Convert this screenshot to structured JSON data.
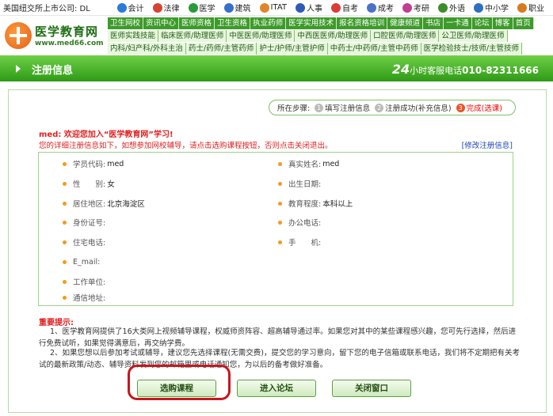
{
  "topbar": {
    "stock": "美国纽交所上市公司: DL",
    "categories": [
      {
        "label": "会计",
        "icon": "accounting-icon",
        "color": "#2d7ad6"
      },
      {
        "label": "法律",
        "icon": "law-icon",
        "color": "#d4442f"
      },
      {
        "label": "医学",
        "icon": "medical-icon",
        "color": "#2a9a3a"
      },
      {
        "label": "建筑",
        "icon": "building-icon",
        "color": "#3670c8"
      },
      {
        "label": "ITAT",
        "icon": "itat-icon",
        "color": "#e0862a"
      },
      {
        "label": "人事",
        "icon": "hr-icon",
        "color": "#2f5bb7"
      },
      {
        "label": "自考",
        "icon": "selfexam-icon",
        "color": "#d93b3b"
      },
      {
        "label": "成考",
        "icon": "adultexam-icon",
        "color": "#4a73c8"
      },
      {
        "label": "考研",
        "icon": "postgrad-icon",
        "color": "#c23e91"
      },
      {
        "label": "外语",
        "icon": "language-icon",
        "color": "#3b8e2a"
      },
      {
        "label": "中小学",
        "icon": "school-icon",
        "color": "#2e6fc2"
      },
      {
        "label": "职业",
        "icon": "career-icon",
        "color": "#d77a20"
      }
    ]
  },
  "logo": {
    "name": "医学教育网",
    "url": "www.med66.com"
  },
  "nav": {
    "row1": [
      "卫生网校",
      "资讯中心",
      "医师资格",
      "卫生资格",
      "执业药师",
      "医学实用技术",
      "报名资格培训",
      "健康频道",
      "书店",
      "一卡通",
      "论坛",
      "博客",
      "首页"
    ],
    "row2": [
      "医师实践技能",
      "临床医师/助理医师",
      "中医医师/助理医师",
      "中西医医师/助理医师",
      "口腔医师/助理医师",
      "公卫医师/助理医师"
    ],
    "row3": [
      "内科/妇产科/外科主治",
      "药士/药师/主管药师",
      "护士/护师/主管护师",
      "中药士/中药师/主管中药师",
      "医学检验技士/技师/主管技师"
    ]
  },
  "header": {
    "title": "注册信息",
    "hotline_24": "24",
    "hotline_text": "小时客服电话",
    "hotline_num": "010-82311666"
  },
  "steps": {
    "location": "所在步骤:",
    "items": [
      {
        "num": "1",
        "label": "填写注册信息",
        "active": false
      },
      {
        "num": "2",
        "label": "注册成功(补充信息)",
        "active": false
      },
      {
        "num": "3",
        "label": "完成(选课)",
        "active": true
      }
    ]
  },
  "welcome": {
    "username": "med",
    "text": ": 欢迎您加入“医学教育网”学习!",
    "desc": "您的详细注册信息如下，如想参加网校辅导，请点击选购课程按钮，否则点击关闭退出。",
    "modify_link": "[修改注册信息]"
  },
  "fields": [
    {
      "label": "学员代码:",
      "value": "med"
    },
    {
      "label": "真实姓名:",
      "value": "med"
    },
    {
      "label": "性　　别:",
      "value": "女"
    },
    {
      "label": "出生日期:",
      "value": ""
    },
    {
      "label": "居住地区:",
      "value": "北京海淀区"
    },
    {
      "label": "教育程度:",
      "value": "本科以上"
    },
    {
      "label": "身份证号:",
      "value": ""
    },
    {
      "label": "办公电话:",
      "value": ""
    },
    {
      "label": "住宅电话:",
      "value": ""
    },
    {
      "label": "手　　机:",
      "value": ""
    },
    {
      "label": "E_mail:",
      "value": ""
    },
    {
      "label": "工作单位:",
      "value": ""
    },
    {
      "label": "通信地址:",
      "value": ""
    }
  ],
  "notes": {
    "title": "重要提示:",
    "note1": "1、医学教育网提供了16大类网上视频辅导课程，权威师资阵容、超高辅导通过率。如果您对其中的某些课程感兴趣，您可先行选择，然后进行免费试听，如果觉得满意后，再交纳学费。",
    "note2": "2、如果您想以后参加考试或辅导，建议您先选择课程(无需交费)，提交您的学习意向，留下您的电子信箱或联系电话，我们将不定期把有关考试的最新政策/动态、辅导资料发到您的邮箱里或电话通知您，为以后的备考做好准备。"
  },
  "buttons": {
    "select_course": "选购课程",
    "enter_forum": "进入论坛",
    "close_window": "关闭窗口"
  }
}
